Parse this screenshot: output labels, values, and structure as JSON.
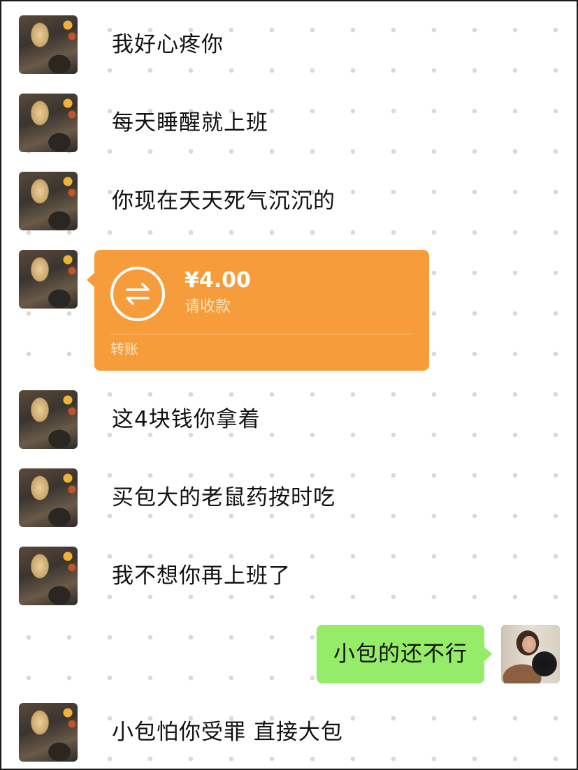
{
  "messages": [
    {
      "text": "我好心疼你"
    },
    {
      "text": "每天睡醒就上班"
    },
    {
      "text": "你现在天天死气沉沉的"
    },
    {
      "transfer": {
        "amount": "¥4.00",
        "status": "请收款",
        "label": "转账",
        "icon": "transfer-arrows-icon",
        "color": "#f79c3a"
      }
    },
    {
      "text": "这4块钱你拿着"
    },
    {
      "text": "买包大的老鼠药按时吃"
    },
    {
      "text": "我不想你再上班了"
    },
    {
      "text": "小包的还不行",
      "bubble_color": "#95ec69"
    },
    {
      "text": "小包怕你受罪 直接大包"
    }
  ]
}
